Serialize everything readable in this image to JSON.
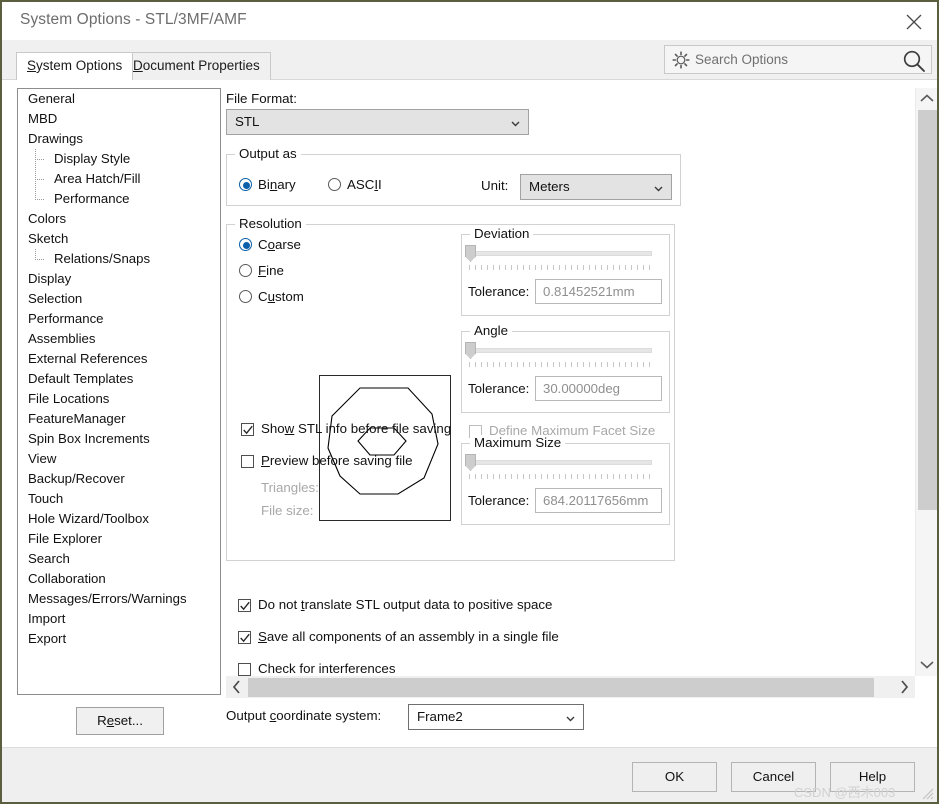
{
  "window": {
    "title": "System Options - STL/3MF/AMF",
    "close_icon": "close-icon"
  },
  "tabs": [
    {
      "label_pre": "S",
      "label_key": "y",
      "label_post": "stem Options",
      "label": "System Options",
      "active": true
    },
    {
      "label_pre": "",
      "label_key": "D",
      "label_post": "ocument Properties",
      "label": "Document Properties",
      "active": false
    }
  ],
  "search": {
    "placeholder": "Search Options",
    "gear_icon": "gear-icon",
    "magnifier_icon": "search-icon"
  },
  "sidebar": {
    "items": [
      {
        "label": "General",
        "level": 0
      },
      {
        "label": "MBD",
        "level": 0
      },
      {
        "label": "Drawings",
        "level": 0
      },
      {
        "label": "Display Style",
        "level": 1
      },
      {
        "label": "Area Hatch/Fill",
        "level": 1
      },
      {
        "label": "Performance",
        "level": 1,
        "last": true
      },
      {
        "label": "Colors",
        "level": 0
      },
      {
        "label": "Sketch",
        "level": 0
      },
      {
        "label": "Relations/Snaps",
        "level": 1,
        "last": true
      },
      {
        "label": "Display",
        "level": 0
      },
      {
        "label": "Selection",
        "level": 0
      },
      {
        "label": "Performance",
        "level": 0
      },
      {
        "label": "Assemblies",
        "level": 0
      },
      {
        "label": "External References",
        "level": 0
      },
      {
        "label": "Default Templates",
        "level": 0
      },
      {
        "label": "File Locations",
        "level": 0
      },
      {
        "label": "FeatureManager",
        "level": 0
      },
      {
        "label": "Spin Box Increments",
        "level": 0
      },
      {
        "label": "View",
        "level": 0
      },
      {
        "label": "Backup/Recover",
        "level": 0
      },
      {
        "label": "Touch",
        "level": 0
      },
      {
        "label": "Hole Wizard/Toolbox",
        "level": 0
      },
      {
        "label": "File Explorer",
        "level": 0
      },
      {
        "label": "Search",
        "level": 0
      },
      {
        "label": "Collaboration",
        "level": 0
      },
      {
        "label": "Messages/Errors/Warnings",
        "level": 0
      },
      {
        "label": "Import",
        "level": 0
      },
      {
        "label": "Export",
        "level": 0
      }
    ]
  },
  "reset_button": {
    "label": "Reset..."
  },
  "main": {
    "file_format_label": "File Format:",
    "file_format_value": "STL",
    "output_as": {
      "title": "Output as",
      "binary_label": "Binary",
      "binary_selected": true,
      "ascii_label": "ASCII",
      "ascii_selected": false,
      "unit_label": "Unit:",
      "unit_value": "Meters"
    },
    "resolution": {
      "title": "Resolution",
      "options": [
        {
          "label": "Coarse",
          "selected": true
        },
        {
          "label": "Fine",
          "selected": false
        },
        {
          "label": "Custom",
          "selected": false
        }
      ]
    },
    "deviation": {
      "title": "Deviation",
      "tolerance_label": "Tolerance:",
      "tolerance_value": "0.81452521mm",
      "slider_percent": 0
    },
    "angle": {
      "title": "Angle",
      "tolerance_label": "Tolerance:",
      "tolerance_value": "30.00000deg",
      "slider_percent": 0
    },
    "define_max_facet": {
      "label": "Define Maximum Facet Size",
      "checked": false
    },
    "maximum_size": {
      "title": "Maximum Size",
      "tolerance_label": "Tolerance:",
      "tolerance_value": "684.20117656mm",
      "slider_percent": 0
    },
    "show_stl_info": {
      "label": "Show STL info before file saving",
      "checked": true
    },
    "preview_before_saving": {
      "label": "Preview before saving file",
      "checked": false
    },
    "triangles_label": "Triangles:",
    "file_size_label": "File size:",
    "do_not_translate": {
      "label": "Do not translate STL output data to positive space",
      "checked": true
    },
    "save_all_components": {
      "label": "Save all components of an assembly in a single file",
      "checked": true
    },
    "check_interferences": {
      "label": "Check for interferences",
      "checked": false
    }
  },
  "coordinate_system": {
    "label": "Output coordinate system:",
    "value": "Frame2"
  },
  "footer": {
    "ok": "OK",
    "cancel": "Cancel",
    "help": "Help"
  },
  "watermark": "CSDN @西木003",
  "colors": {
    "accent": "#0a5fa8",
    "dialog_border": "#5b5f3f",
    "tab_band": "#f0f0f0",
    "scrollbar_thumb": "#cdcdcd"
  }
}
